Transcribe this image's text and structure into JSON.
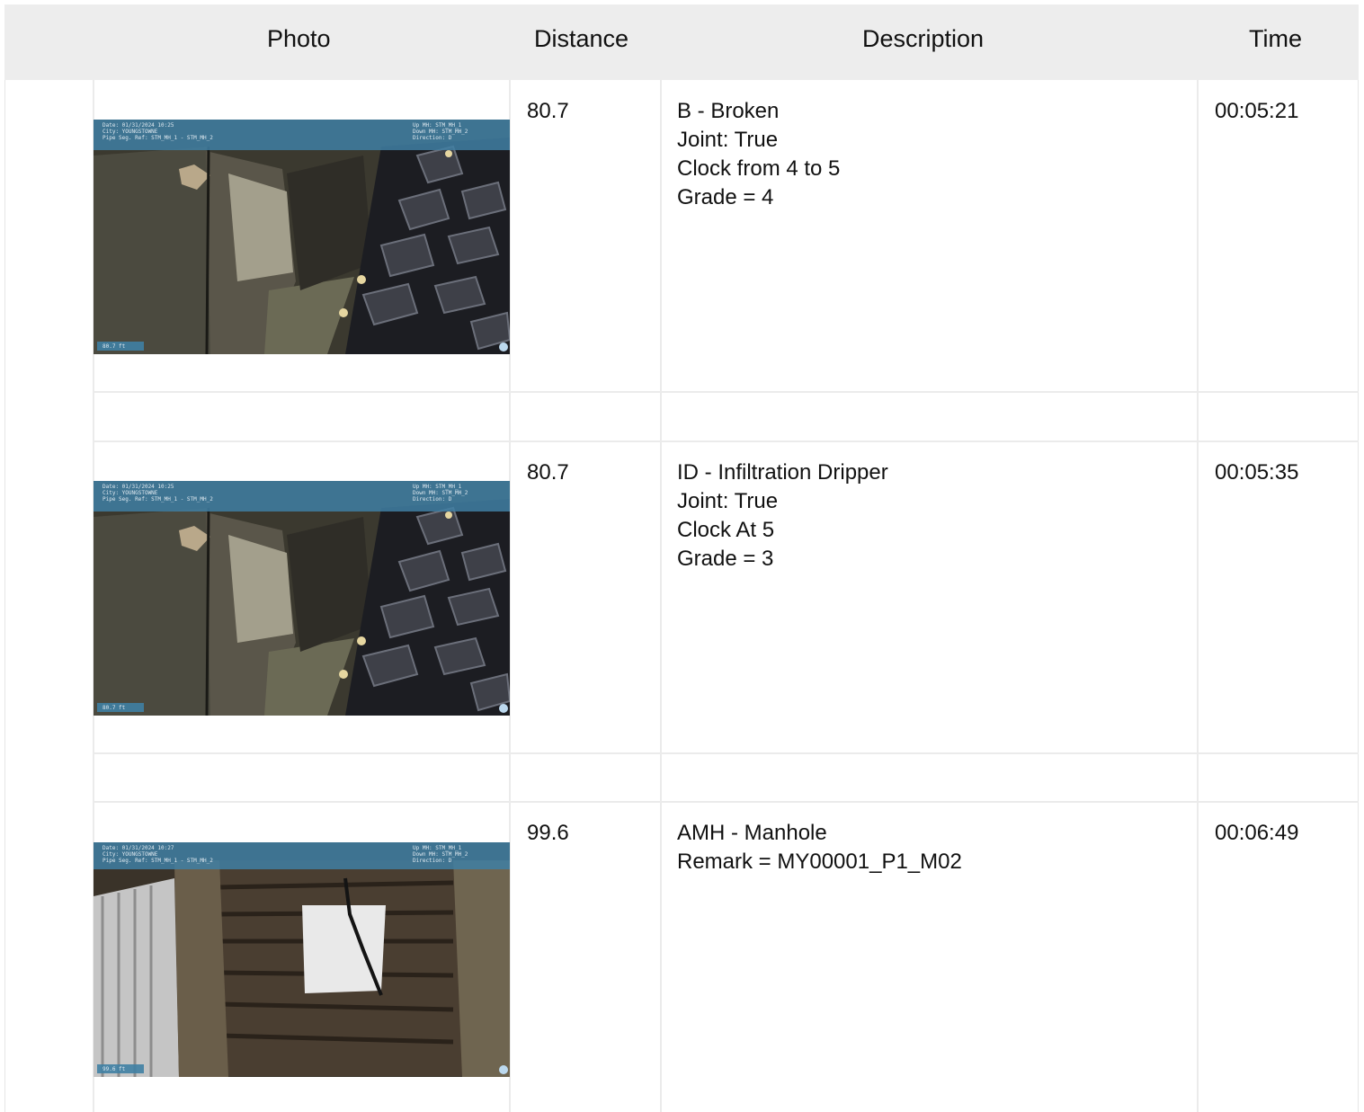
{
  "table": {
    "headers": {
      "photo": "Photo",
      "distance": "Distance",
      "description": "Description",
      "time": "Time"
    },
    "rows": [
      {
        "distance": "80.7",
        "description": [
          "B - Broken",
          "Joint: True",
          "Clock from 4 to 5",
          "Grade = 4"
        ],
        "time": "00:05:21",
        "photo": {
          "scene": "pipe-joint-with-tire",
          "osd_left": "Date: 01/31/2024 10:25\nCity: YOUNGSTOWNE\nPipe Seg. Ref: STM_MH_1 - STM_MH_2",
          "osd_right": "Up MH: STM_MH_1\nDown MH: STM_MH_2\nDirection: D",
          "distance_tag": "80.7 ft"
        }
      },
      {
        "distance": "80.7",
        "description": [
          "ID - Infiltration Dripper",
          "Joint: True",
          "Clock At 5",
          "Grade = 3"
        ],
        "time": "00:05:35",
        "photo": {
          "scene": "pipe-joint-with-tire",
          "osd_left": "Date: 01/31/2024 10:25\nCity: YOUNGSTOWNE\nPipe Seg. Ref: STM_MH_1 - STM_MH_2",
          "osd_right": "Up MH: STM_MH_1\nDown MH: STM_MH_2\nDirection: D",
          "distance_tag": "80.7 ft"
        }
      },
      {
        "distance": "99.6",
        "description": [
          "AMH - Manhole",
          "Remark = MY00001_P1_M02"
        ],
        "time": "00:06:49",
        "photo": {
          "scene": "manhole",
          "osd_left": "Date: 01/31/2024 10:27\nCity: YOUNGSTOWNE\nPipe Seg. Ref: STM_MH_1 - STM_MH_2",
          "osd_right": "Up MH: STM_MH_1\nDown MH: STM_MH_2\nDirection: D",
          "distance_tag": "99.6 ft"
        }
      }
    ]
  },
  "colors": {
    "header_bg": "#ededed",
    "grid_line": "#ebebeb",
    "osd_band": "#3f7fa3"
  }
}
